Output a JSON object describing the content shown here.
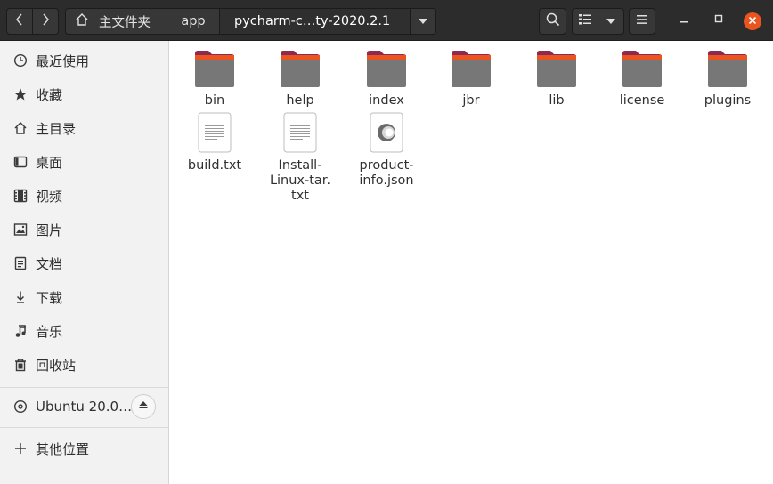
{
  "window": {
    "title": "pycharm-community-2020.2.1",
    "accent_color": "#e95420",
    "header_bg": "#2c2c2c"
  },
  "toolbar": {
    "back_icon": "chevron-left-icon",
    "forward_icon": "chevron-right-icon",
    "breadcrumbs": [
      {
        "label": "主文件夹",
        "icon": "home-icon"
      },
      {
        "label": "app"
      },
      {
        "label": "pycharm-c…ty-2020.2.1"
      }
    ],
    "path_menu_icon": "chevron-down-icon",
    "search_icon": "search-icon",
    "view_icon": "list-view-icon",
    "view_menu_icon": "chevron-down-icon",
    "menu_icon": "hamburger-icon"
  },
  "window_controls": [
    "minimize-icon",
    "maximize-icon",
    "close-icon"
  ],
  "sidebar": {
    "places": [
      {
        "label": "最近使用",
        "icon": "clock-icon"
      },
      {
        "label": "收藏",
        "icon": "star-icon"
      },
      {
        "label": "主目录",
        "icon": "home-icon"
      },
      {
        "label": "桌面",
        "icon": "desktop-icon"
      },
      {
        "label": "视频",
        "icon": "film-icon"
      },
      {
        "label": "图片",
        "icon": "image-icon"
      },
      {
        "label": "文档",
        "icon": "document-icon"
      },
      {
        "label": "下载",
        "icon": "download-icon"
      },
      {
        "label": "音乐",
        "icon": "music-icon"
      },
      {
        "label": "回收站",
        "icon": "trash-icon"
      }
    ],
    "devices": [
      {
        "label": "Ubuntu 20.0…",
        "icon": "disc-icon",
        "action_icon": "eject-icon"
      }
    ],
    "other": {
      "label": "其他位置",
      "icon": "plus-icon"
    }
  },
  "files": [
    {
      "name": "bin",
      "type": "folder"
    },
    {
      "name": "help",
      "type": "folder"
    },
    {
      "name": "index",
      "type": "folder"
    },
    {
      "name": "jbr",
      "type": "folder"
    },
    {
      "name": "lib",
      "type": "folder"
    },
    {
      "name": "license",
      "type": "folder"
    },
    {
      "name": "plugins",
      "type": "folder"
    },
    {
      "name": "build.txt",
      "type": "text"
    },
    {
      "name": "Install-\nLinux-tar.\ntxt",
      "type": "text"
    },
    {
      "name": "product-\ninfo.json",
      "type": "json"
    }
  ]
}
